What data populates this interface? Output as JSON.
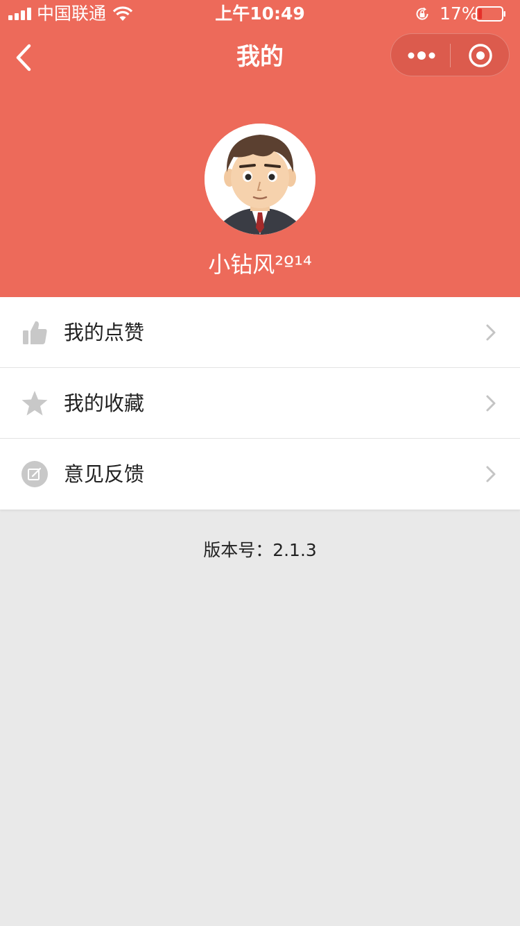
{
  "status_bar": {
    "carrier": "中国联通",
    "time": "上午10:49",
    "battery_percent": "17%",
    "battery_level": 0.17,
    "signal_icon": "signal-icon",
    "wifi_icon": "wifi-icon",
    "lock_icon": "rotation-lock-icon"
  },
  "nav": {
    "title": "我的",
    "back_icon": "chevron-left-icon",
    "more_icon": "more-dots-icon",
    "close_icon": "target-close-icon"
  },
  "profile": {
    "username": "小钻风²º¹⁴"
  },
  "menu": {
    "items": [
      {
        "label": "我的点赞",
        "icon": "thumbs-up-icon"
      },
      {
        "label": "我的收藏",
        "icon": "star-icon"
      },
      {
        "label": "意见反馈",
        "icon": "edit-feedback-icon"
      }
    ]
  },
  "footer": {
    "version": "版本号：2.1.3"
  },
  "colors": {
    "header": "#ed6a5a",
    "page_background": "#e9e9e9",
    "icon_gray": "#c8c8c8"
  }
}
